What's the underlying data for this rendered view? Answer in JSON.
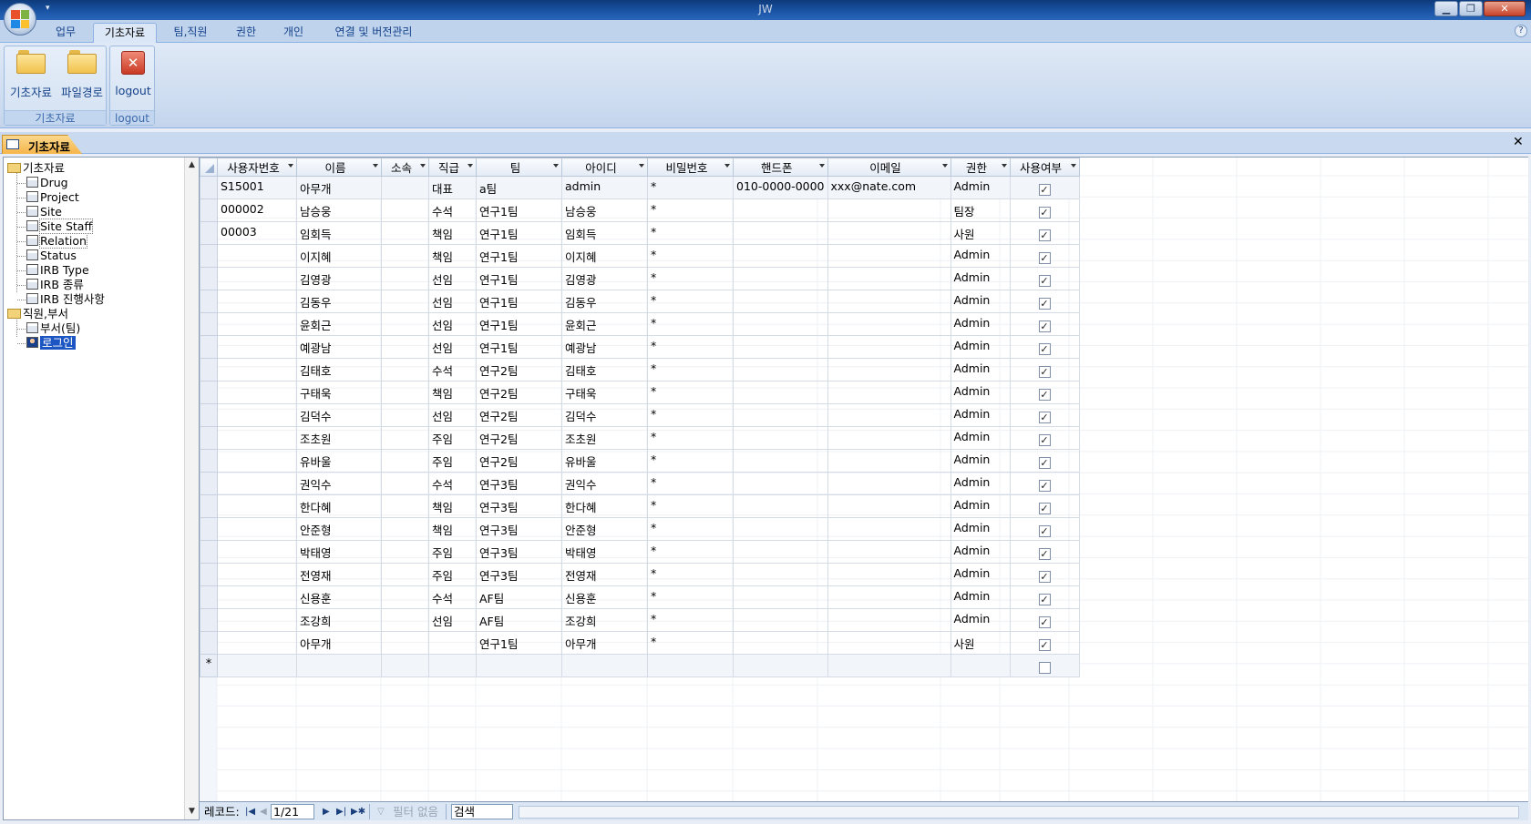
{
  "window": {
    "title": "JW"
  },
  "ribbon": {
    "tabs": [
      {
        "label": "업무"
      },
      {
        "label": "기초자료"
      },
      {
        "label": "팀,직원"
      },
      {
        "label": "권한"
      },
      {
        "label": "개인"
      },
      {
        "label": "연결 및 버전관리"
      }
    ],
    "active_tab": "기초자료",
    "groups": [
      {
        "label": "기초자료",
        "buttons": [
          {
            "label": "기초자료"
          },
          {
            "label": "파일경로"
          }
        ]
      },
      {
        "label": "logout",
        "buttons": [
          {
            "label": "logout"
          }
        ]
      }
    ]
  },
  "document": {
    "tab_label": "기초자료"
  },
  "tree": {
    "nodes": [
      {
        "label": "기초자료"
      },
      {
        "label": "Drug"
      },
      {
        "label": "Project"
      },
      {
        "label": "Site"
      },
      {
        "label": "Site Staff"
      },
      {
        "label": "Relation"
      },
      {
        "label": "Status"
      },
      {
        "label": "IRB Type"
      },
      {
        "label": "IRB 종류"
      },
      {
        "label": "IRB 진행사항"
      },
      {
        "label": "직원,부서"
      },
      {
        "label": "부서(팀)"
      },
      {
        "label": "로그인"
      }
    ],
    "selected": "로그인"
  },
  "grid": {
    "columns": [
      "사용자번호",
      "이름",
      "소속",
      "직급",
      "팀",
      "아이디",
      "비밀번호",
      "핸드폰",
      "이메일",
      "권한",
      "사용여부"
    ],
    "rows": [
      [
        "S15001",
        "아무개",
        "",
        "대표",
        "a팀",
        "admin",
        "*",
        "010-0000-0000",
        "xxx@nate.com",
        "Admin",
        "✓"
      ],
      [
        "000002",
        "남승웅",
        "",
        "수석",
        "연구1팀",
        "남승웅",
        "*",
        "",
        "",
        "팀장",
        "✓"
      ],
      [
        "00003",
        "임회득",
        "",
        "책임",
        "연구1팀",
        "임회득",
        "*",
        "",
        "",
        "사원",
        "✓"
      ],
      [
        "",
        "이지혜",
        "",
        "책임",
        "연구1팀",
        "이지혜",
        "*",
        "",
        "",
        "Admin",
        "✓"
      ],
      [
        "",
        "김영광",
        "",
        "선임",
        "연구1팀",
        "김영광",
        "*",
        "",
        "",
        "Admin",
        "✓"
      ],
      [
        "",
        "김동우",
        "",
        "선임",
        "연구1팀",
        "김동우",
        "*",
        "",
        "",
        "Admin",
        "✓"
      ],
      [
        "",
        "윤회근",
        "",
        "선임",
        "연구1팀",
        "윤회근",
        "*",
        "",
        "",
        "Admin",
        "✓"
      ],
      [
        "",
        "예광남",
        "",
        "선임",
        "연구1팀",
        "예광남",
        "*",
        "",
        "",
        "Admin",
        "✓"
      ],
      [
        "",
        "김태호",
        "",
        "수석",
        "연구2팀",
        "김태호",
        "*",
        "",
        "",
        "Admin",
        "✓"
      ],
      [
        "",
        "구태욱",
        "",
        "책임",
        "연구2팀",
        "구태욱",
        "*",
        "",
        "",
        "Admin",
        "✓"
      ],
      [
        "",
        "김덕수",
        "",
        "선임",
        "연구2팀",
        "김덕수",
        "*",
        "",
        "",
        "Admin",
        "✓"
      ],
      [
        "",
        "조초원",
        "",
        "주임",
        "연구2팀",
        "조초원",
        "*",
        "",
        "",
        "Admin",
        "✓"
      ],
      [
        "",
        "유바울",
        "",
        "주임",
        "연구2팀",
        "유바울",
        "*",
        "",
        "",
        "Admin",
        "✓"
      ],
      [
        "",
        "권익수",
        "",
        "수석",
        "연구3팀",
        "권익수",
        "*",
        "",
        "",
        "Admin",
        "✓"
      ],
      [
        "",
        "한다혜",
        "",
        "책임",
        "연구3팀",
        "한다혜",
        "*",
        "",
        "",
        "Admin",
        "✓"
      ],
      [
        "",
        "안준형",
        "",
        "책임",
        "연구3팀",
        "안준형",
        "*",
        "",
        "",
        "Admin",
        "✓"
      ],
      [
        "",
        "박태영",
        "",
        "주임",
        "연구3팀",
        "박태영",
        "*",
        "",
        "",
        "Admin",
        "✓"
      ],
      [
        "",
        "전영재",
        "",
        "주임",
        "연구3팀",
        "전영재",
        "*",
        "",
        "",
        "Admin",
        "✓"
      ],
      [
        "",
        "신용훈",
        "",
        "수석",
        "AF팀",
        "신용훈",
        "*",
        "",
        "",
        "Admin",
        "✓"
      ],
      [
        "",
        "조강희",
        "",
        "선임",
        "AF팀",
        "조강희",
        "*",
        "",
        "",
        "Admin",
        "✓"
      ],
      [
        "",
        "아무개",
        "",
        "",
        "연구1팀",
        "아무개",
        "*",
        "",
        "",
        "사원",
        "✓"
      ]
    ],
    "new_row_marker": "*"
  },
  "navigation": {
    "record_label": "레코드:",
    "position": "1/21",
    "filter_label": "필터 없음",
    "search_label": "검색"
  },
  "colors": {
    "accent": "#1c56c3",
    "doc_tab": "#f5b54a",
    "ribbon": "#cddcf0"
  }
}
